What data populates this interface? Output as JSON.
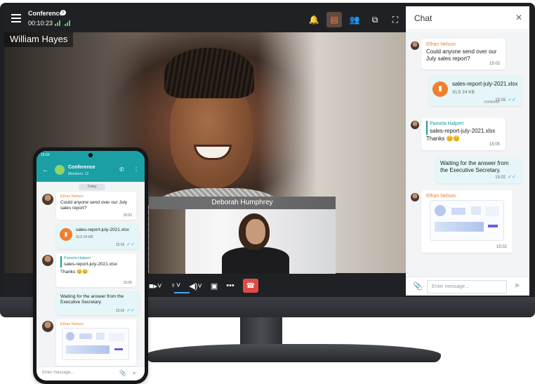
{
  "colors": {
    "accent_orange": "#f07f2f",
    "accent_teal": "#1a9a9c",
    "signal_green": "#3fce6b",
    "hangup_red": "#e14b47",
    "chat_bg": "#f2f4f6",
    "outgoing_bubble": "#e4f6f7"
  },
  "topbar": {
    "title": "Conference",
    "timer": "00:10:23",
    "icons": [
      "menu-icon",
      "info-icon",
      "signal-icon",
      "bell-icon",
      "chat-icon",
      "participants-icon",
      "share-screen-icon",
      "fullscreen-icon"
    ],
    "active_button": "chat"
  },
  "main_video": {
    "participant_name": "William Hayes"
  },
  "secondary_video": {
    "participant_name": "Deborah Humphrey"
  },
  "controls": {
    "icons": [
      "camera-icon",
      "microphone-icon",
      "speaker-icon",
      "screen-share-icon",
      "more-icon",
      "hangup-icon"
    ]
  },
  "chat": {
    "title": "Chat",
    "close_glyph": "✕",
    "messages": [
      {
        "sender": "Ethan Nelson",
        "text": "Could anyone send over our July sales report?",
        "time": "15:02",
        "direction": "in"
      },
      {
        "file_name": "sales-report-july-2021.xlsx",
        "file_meta": "XLS 24 KB",
        "tag": "#3440456",
        "time": "15:03",
        "direction": "out"
      },
      {
        "sender": "Pamela Halpert",
        "quote": "sales-report-july-2021.xlsx",
        "text": "Thanks 😊😊",
        "time": "15:05",
        "direction": "in"
      },
      {
        "text": "Waiting for the answer from the Executive Secretary.",
        "time": "15:02",
        "direction": "out"
      },
      {
        "sender": "Ethan Nelson",
        "attachment": "dashboard-image",
        "time": "15:02",
        "direction": "in"
      }
    ],
    "input_placeholder": "Enter message..."
  },
  "phone": {
    "status_time": "15:03",
    "title": "Conference",
    "subtitle": "Members: 12",
    "day_label": "Today",
    "messages": [
      {
        "sender": "Ethan Nelson",
        "text": "Could anyone send over our July sales report?",
        "time": "15:02"
      },
      {
        "file_name": "sales-report-july-2021.xlsx",
        "file_meta": "XLS 24 KB",
        "time": "15:03"
      },
      {
        "sender": "Pamela Halpert",
        "quote": "sales-report-july-2021.xlsx",
        "text": "Thanks 😊😊",
        "time": "15:05"
      },
      {
        "text": "Waiting for the answer from the Executive Secretary.",
        "time": "15:02"
      },
      {
        "sender": "Ethan Nelson",
        "attachment": "dashboard-image"
      }
    ],
    "input_placeholder": "Enter message..."
  }
}
